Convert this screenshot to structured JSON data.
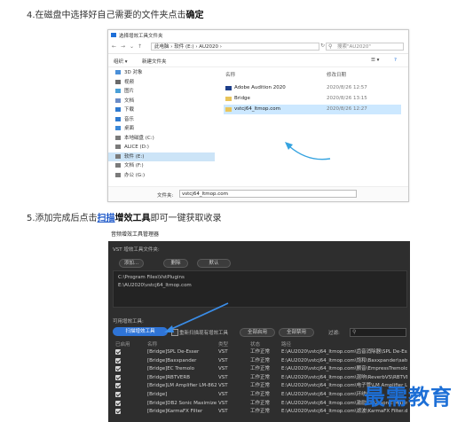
{
  "step4": {
    "prefix": "4.在磁盘中选择好自己需要的文件夹点击",
    "bold": "确定"
  },
  "step5": {
    "prefix": "5.添加完成后点击",
    "link": "扫描",
    "bold": "增效工具",
    "suffix": "即可一键获取收录"
  },
  "dialog": {
    "title": "选择增效工具文件夹",
    "path": "此电脑 › 软件 (E:) › AU2020 ›",
    "search_placeholder": "搜索\"AU2020\"",
    "toolbar": {
      "organize": "组织 ▾",
      "new_folder": "新建文件夹"
    },
    "sidebar": [
      {
        "label": "3D 对象",
        "icon": "3d-objects-icon",
        "color": "#4a8fd8"
      },
      {
        "label": "视频",
        "icon": "video-icon",
        "color": "#6a6a6a"
      },
      {
        "label": "图片",
        "icon": "pictures-icon",
        "color": "#4aa0d8"
      },
      {
        "label": "文档",
        "icon": "documents-icon",
        "color": "#6b8cc7"
      },
      {
        "label": "下载",
        "icon": "downloads-icon",
        "color": "#2f7ad0"
      },
      {
        "label": "音乐",
        "icon": "music-icon",
        "color": "#2f7ad0"
      },
      {
        "label": "桌面",
        "icon": "desktop-icon",
        "color": "#3a88d8"
      },
      {
        "label": "本地磁盘 (C:)",
        "icon": "drive-icon",
        "color": "#7a7a7a"
      },
      {
        "label": "ALICE (D:)",
        "icon": "drive-icon",
        "color": "#7a7a7a"
      },
      {
        "label": "软件 (E:)",
        "icon": "drive-icon",
        "color": "#7a7a7a",
        "selected": true
      },
      {
        "label": "文档 (F:)",
        "icon": "drive-icon",
        "color": "#7a7a7a"
      },
      {
        "label": "办公 (G:)",
        "icon": "drive-icon",
        "color": "#7a7a7a"
      }
    ],
    "columns": {
      "name": "名称",
      "date": "修改日期"
    },
    "files": [
      {
        "name": "Adobe Audition 2020",
        "date": "2020/8/26 12:57",
        "icon": "app-folder-icon"
      },
      {
        "name": "Bridge",
        "date": "2020/8/26 13:15",
        "icon": "folder-icon"
      },
      {
        "name": "vstcj64_ltmop.com",
        "date": "2020/8/26 12:27",
        "icon": "folder-icon",
        "selected": true
      }
    ],
    "filename_label": "文件夹:",
    "filename_value": "vstcj64_ltmop.com"
  },
  "manager": {
    "title": "音频增效工具管理器",
    "folders_label": "VST 增效工具文件夹:",
    "buttons": {
      "add": "添加...",
      "remove": "删除",
      "default": "默认"
    },
    "folders": [
      "C:\\Program Files\\VstPlugins",
      "E:\\AU2020\\vstcj64_ltmop.com"
    ],
    "available_label": "可用增效工具:",
    "scan_button": "扫描增效工具",
    "rescan_label": "重新扫描现有增效工具",
    "enable_all": "全部启用",
    "disable_all": "全部禁用",
    "filter_label": "过滤:",
    "table_headers": [
      "已启用",
      "名称",
      "类型",
      "状态",
      "路径"
    ],
    "plugins": [
      {
        "name": "[Bridge]SPL De-Esser",
        "type": "VST",
        "status": "工作正常",
        "path": "E:\\AU2020\\vstcj64_ltmop.com\\齿音消除器\\SPL De-Esser.d"
      },
      {
        "name": "[Bridge]Baxxpander",
        "type": "VST",
        "status": "工作正常",
        "path": "E:\\AU2020\\vstcj64_ltmop.com\\饱和\\Baxxpander\\saturated\\ba"
      },
      {
        "name": "[Bridge]EC Tremolo",
        "type": "VST",
        "status": "工作正常",
        "path": "E:\\AU2020\\vstcj64_ltmop.com\\颤音\\EmpressTremolo\\Emp"
      },
      {
        "name": "[Bridge]RBTVERB",
        "type": "VST",
        "status": "工作正常",
        "path": "E:\\AU2020\\vstcj64_ltmop.com\\混响\\ReverbVS\\RBTVERB.d"
      },
      {
        "name": "[Bridge]LM Amplifier LM-862",
        "type": "VST",
        "status": "工作正常",
        "path": "E:\\AU2020\\vstcj64_ltmop.com\\电子管\\LM Amplifier LM-862"
      },
      {
        "name": "[Bridge]",
        "type": "VST",
        "status": "工作正常",
        "path": "E:\\AU2020\\vstcj64_ltmop.com\\环绕\\..."
      },
      {
        "name": "[Bridge]DB2 Sonic Maximizer",
        "type": "VST",
        "status": "工作正常",
        "path": "E:\\AU2020\\vstcj64_ltmop.com\\激励\\DB2 Sonic Maximizer"
      },
      {
        "name": "[Bridge]KarmaFX Filter",
        "type": "VST",
        "status": "工作正常",
        "path": "E:\\AU2020\\vstcj64_ltmop.com\\滤波\\KarmaFX Filter.d"
      }
    ]
  },
  "watermark": "最需教育"
}
